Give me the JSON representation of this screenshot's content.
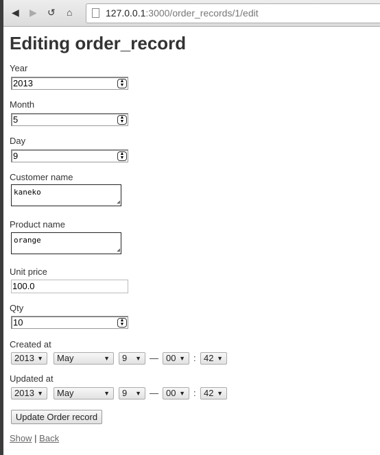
{
  "browser": {
    "url_host": "127.0.0.1",
    "url_rest": ":3000/order_records/1/edit"
  },
  "page": {
    "title": "Editing order_record"
  },
  "form": {
    "year": {
      "label": "Year",
      "value": "2013"
    },
    "month": {
      "label": "Month",
      "value": "5"
    },
    "day": {
      "label": "Day",
      "value": "9"
    },
    "customer_name": {
      "label": "Customer name",
      "value": "kaneko"
    },
    "product_name": {
      "label": "Product name",
      "value": "orange"
    },
    "unit_price": {
      "label": "Unit price",
      "value": "100.0"
    },
    "qty": {
      "label": "Qty",
      "value": "10"
    },
    "created_at": {
      "label": "Created at",
      "year": "2013",
      "month": "May",
      "day": "9",
      "hour": "00",
      "minute": "42"
    },
    "updated_at": {
      "label": "Updated at",
      "year": "2013",
      "month": "May",
      "day": "9",
      "hour": "00",
      "minute": "42"
    },
    "date_sep": "—",
    "time_sep": ":",
    "submit": "Update Order record"
  },
  "links": {
    "show": "Show",
    "sep": "|",
    "back": "Back"
  }
}
